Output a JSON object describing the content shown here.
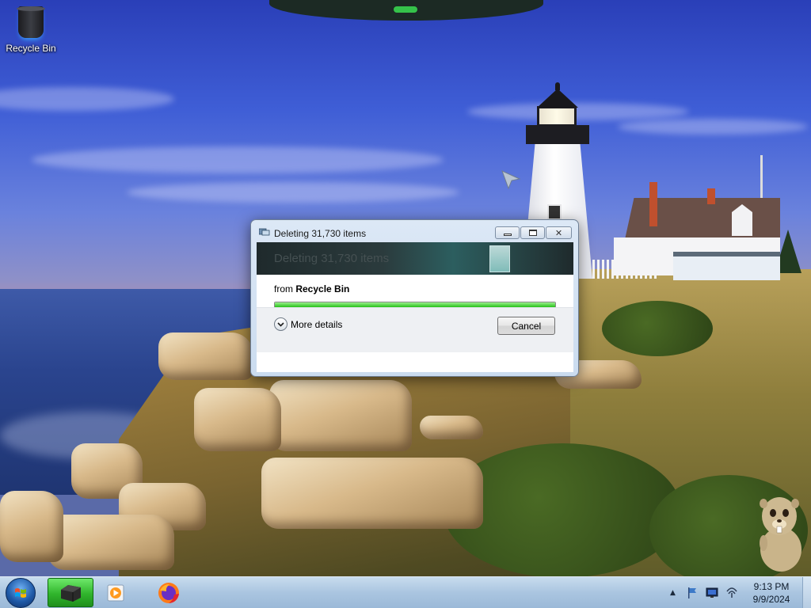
{
  "desktop": {
    "icons": [
      {
        "label": "Recycle Bin",
        "icon": "recycle-bin-icon"
      }
    ]
  },
  "dialog": {
    "title": "Deleting 31,730 items",
    "banner_text": "Deleting 31,730 items",
    "from_label": "from",
    "from_source": "Recycle Bin",
    "progress_fraction": 1.0,
    "more_details_label": "More details",
    "cancel_label": "Cancel",
    "caption_buttons": [
      "minimize",
      "maximize",
      "close"
    ]
  },
  "taskbar": {
    "start_icon": "windows-start-orb-icon",
    "pinned": [
      {
        "name": "windows-explorer",
        "icon": "explorer-window-icon",
        "active": true
      },
      {
        "name": "media-player",
        "icon": "media-player-icon",
        "active": false
      },
      {
        "name": "firefox",
        "icon": "firefox-icon",
        "active": false
      }
    ],
    "tray_icons": [
      "show-hidden-icons-chevron",
      "flag-icon",
      "display-icon",
      "network-icon"
    ],
    "clock": {
      "time": "9:13 PM",
      "date": "9/9/2024"
    }
  },
  "colors": {
    "progress_green": "#29c21b",
    "taskbar_active": "#30b52c",
    "dialog_frame": "#cbdcef"
  }
}
